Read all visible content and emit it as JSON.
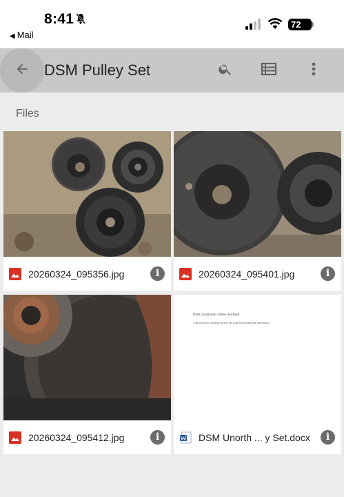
{
  "status_bar": {
    "time": "8:41",
    "back_app": "Mail",
    "battery": "72"
  },
  "app_bar": {
    "title": "DSM Pulley Set",
    "icons": [
      "arrow-back-icon",
      "search-icon",
      "list-view-icon",
      "more-vert-icon"
    ]
  },
  "section_label": "Files",
  "files": [
    {
      "name": "20260324_095356.jpg",
      "type": "image",
      "icon": "image-file-icon"
    },
    {
      "name": "20260324_095401.jpg",
      "type": "image",
      "icon": "image-file-icon"
    },
    {
      "name": "20260324_095412.jpg",
      "type": "image",
      "icon": "image-file-icon"
    },
    {
      "name": "DSM Unorth ... y Set.docx",
      "type": "document",
      "icon": "word-doc-icon",
      "preview_title": "DSM Unorthodox Pulley Set $150",
      "preview_body": "This is all four pulleys for the set and will include the alternator..."
    }
  ],
  "colors": {
    "app_bar": "#c8c8c8",
    "background": "#ececec",
    "image_icon": "#d93025",
    "doc_icon": "#2b579a"
  }
}
